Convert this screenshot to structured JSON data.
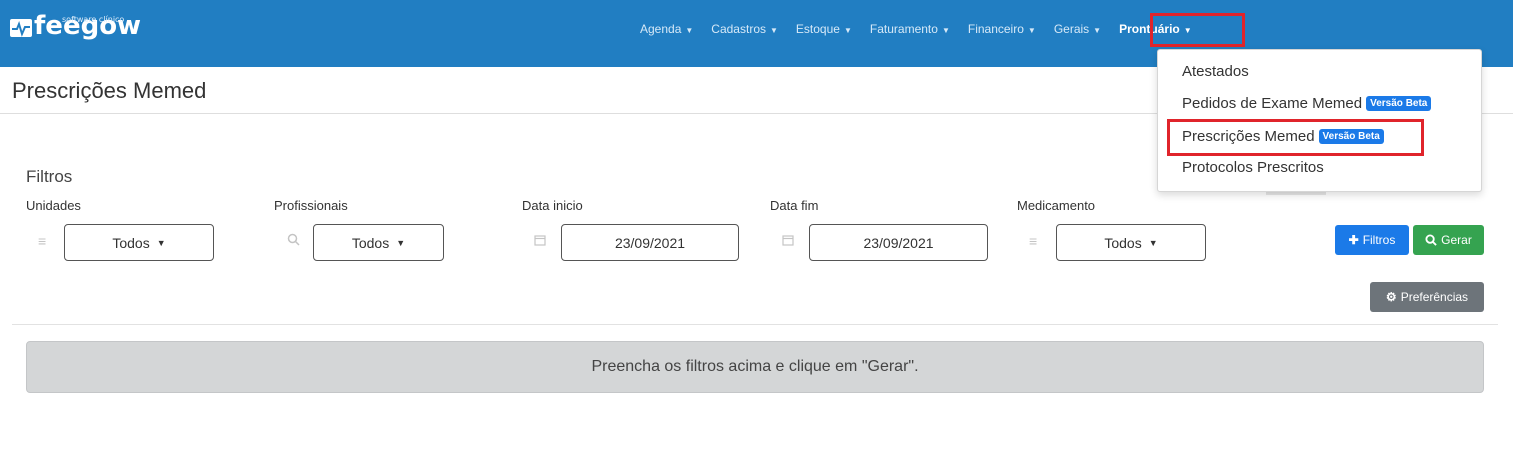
{
  "header": {
    "logo_text": "feegow",
    "logo_tagline": "software clínico",
    "nav": [
      {
        "label": "Agenda",
        "active": false
      },
      {
        "label": "Cadastros",
        "active": false
      },
      {
        "label": "Estoque",
        "active": false
      },
      {
        "label": "Faturamento",
        "active": false
      },
      {
        "label": "Financeiro",
        "active": false
      },
      {
        "label": "Gerais",
        "active": false
      },
      {
        "label": "Prontuário",
        "active": true
      }
    ],
    "caret_icon": "caret-down-icon"
  },
  "dropdown": {
    "items": [
      {
        "label": "Atestados",
        "badge": ""
      },
      {
        "label": "Pedidos de Exame Memed",
        "badge": "Versão Beta"
      },
      {
        "label": "Prescrições Memed",
        "badge": "Versão Beta"
      },
      {
        "label": "Protocolos Prescritos",
        "badge": ""
      }
    ],
    "badge_color": "#1b7ae8"
  },
  "page": {
    "title": "Prescrições Memed"
  },
  "filters": {
    "heading": "Filtros",
    "unidades": {
      "label": "Unidades",
      "value": "Todos",
      "icon": "list-icon"
    },
    "profissionais": {
      "label": "Profissionais",
      "value": "Todos",
      "icon": "search-icon"
    },
    "data_inicio": {
      "label": "Data inicio",
      "value": "23/09/2021",
      "icon": "calendar-icon"
    },
    "data_fim": {
      "label": "Data fim",
      "value": "23/09/2021",
      "icon": "calendar-icon"
    },
    "medicamento": {
      "label": "Medicamento",
      "value": "Todos",
      "icon": "list-icon"
    }
  },
  "actions": {
    "filtros_label": "Filtros",
    "gerar_label": "Gerar",
    "preferencias_label": "Preferências"
  },
  "message": {
    "text": "Preencha os filtros acima e clique em \"Gerar\"."
  },
  "colors": {
    "topbar": "#217ec2",
    "primary": "#1b7ae8",
    "success": "#35a350",
    "secondary": "#6d747a",
    "highlight": "#e0242b"
  }
}
